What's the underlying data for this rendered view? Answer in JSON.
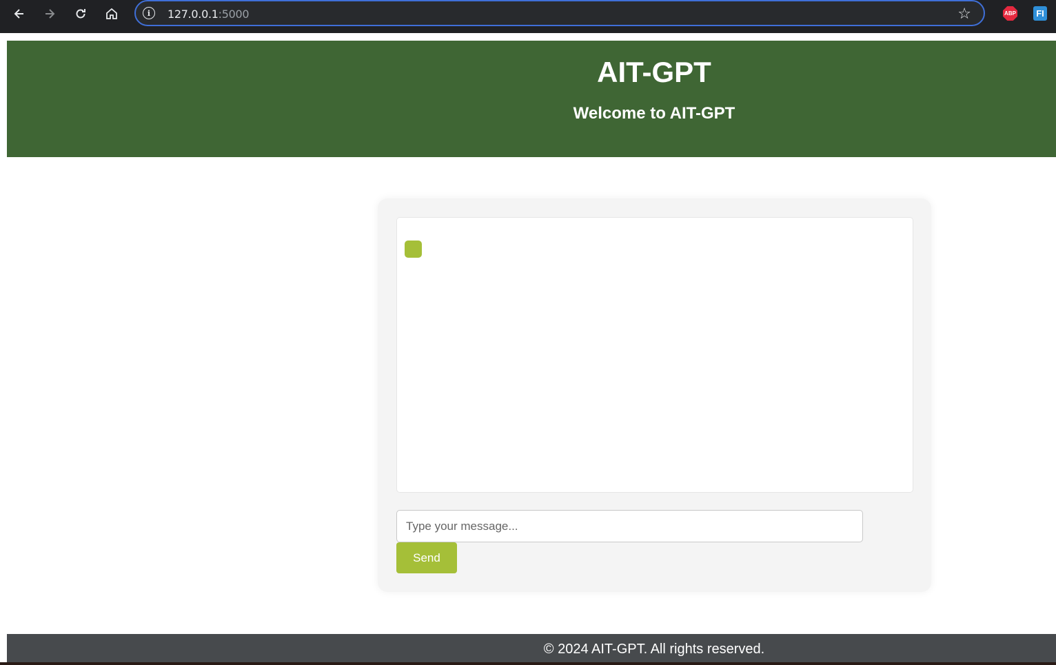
{
  "browser": {
    "url_host": "127.0.0.1",
    "url_port": ":5000",
    "extensions": {
      "abp_label": "ABP",
      "fi_label": "FI"
    }
  },
  "header": {
    "title": "AIT-GPT",
    "subtitle": "Welcome to AIT-GPT"
  },
  "chat": {
    "input_placeholder": "Type your message...",
    "input_value": "",
    "send_label": "Send",
    "accent_color": "#a5bf38"
  },
  "footer": {
    "text": "© 2024 AIT-GPT. All rights reserved."
  },
  "colors": {
    "header_bg": "#3f6634",
    "footer_bg": "#474a4d",
    "accent": "#a5bf38"
  }
}
